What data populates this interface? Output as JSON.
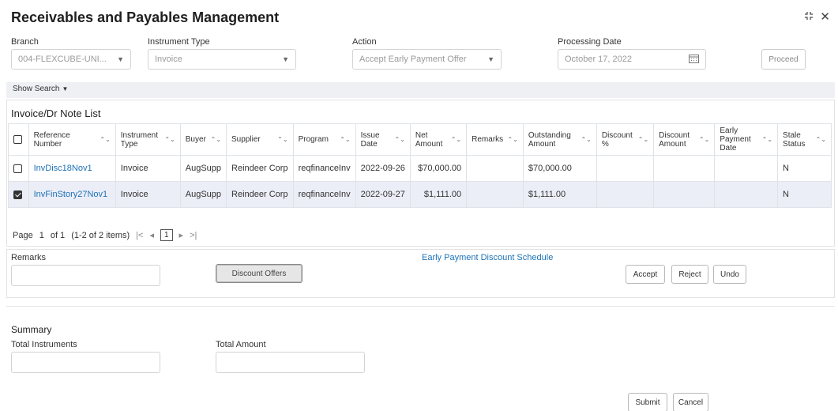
{
  "header": {
    "title": "Receivables and Payables Management"
  },
  "window": {
    "collapse_icon": "collapse-arrows-icon",
    "close_icon": "close-icon"
  },
  "filters": {
    "branch": {
      "label": "Branch",
      "value": "004-FLEXCUBE-UNI..."
    },
    "instrument_type": {
      "label": "Instrument Type",
      "value": "Invoice"
    },
    "action": {
      "label": "Action",
      "value": "Accept Early Payment Offer"
    },
    "processing_date": {
      "label": "Processing Date",
      "value": "October 17, 2022"
    },
    "proceed_label": "Proceed"
  },
  "show_search": "Show Search",
  "list": {
    "title": "Invoice/Dr Note List",
    "columns": [
      "Reference Number",
      "Instrument Type",
      "Buyer",
      "Supplier",
      "Program",
      "Issue Date",
      "Net Amount",
      "Remarks",
      "Outstanding Amount",
      "Discount %",
      "Discount Amount",
      "Early Payment Date",
      "Stale Status"
    ],
    "rows": [
      {
        "checked": false,
        "ref": "InvDisc18Nov1",
        "type": "Invoice",
        "buyer": "AugSupp",
        "supplier": "Reindeer Corp",
        "program": "reqfinanceInv",
        "issue_date": "2022-09-26",
        "net_amount": "$70,000.00",
        "remarks": "",
        "outstanding": "$70,000.00",
        "discount_pct": "",
        "discount_amount": "",
        "early_payment_date": "",
        "stale": "N"
      },
      {
        "checked": true,
        "ref": "InvFinStory27Nov1",
        "type": "Invoice",
        "buyer": "AugSupp",
        "supplier": "Reindeer Corp",
        "program": "reqfinanceInv",
        "issue_date": "2022-09-27",
        "net_amount": "$1,111.00",
        "remarks": "",
        "outstanding": "$1,111.00",
        "discount_pct": "",
        "discount_amount": "",
        "early_payment_date": "",
        "stale": "N"
      }
    ]
  },
  "pager": {
    "page_label": "Page",
    "page": "1",
    "of": "of 1",
    "items": "(1-2 of 2 items)",
    "current": "1"
  },
  "actions": {
    "remarks_label": "Remarks",
    "discount_offers": "Discount Offers",
    "schedule_link": "Early Payment Discount Schedule",
    "accept": "Accept",
    "reject": "Reject",
    "undo": "Undo"
  },
  "summary": {
    "title": "Summary",
    "total_instruments_label": "Total Instruments",
    "total_amount_label": "Total Amount"
  },
  "footer": {
    "submit": "Submit",
    "cancel": "Cancel"
  }
}
